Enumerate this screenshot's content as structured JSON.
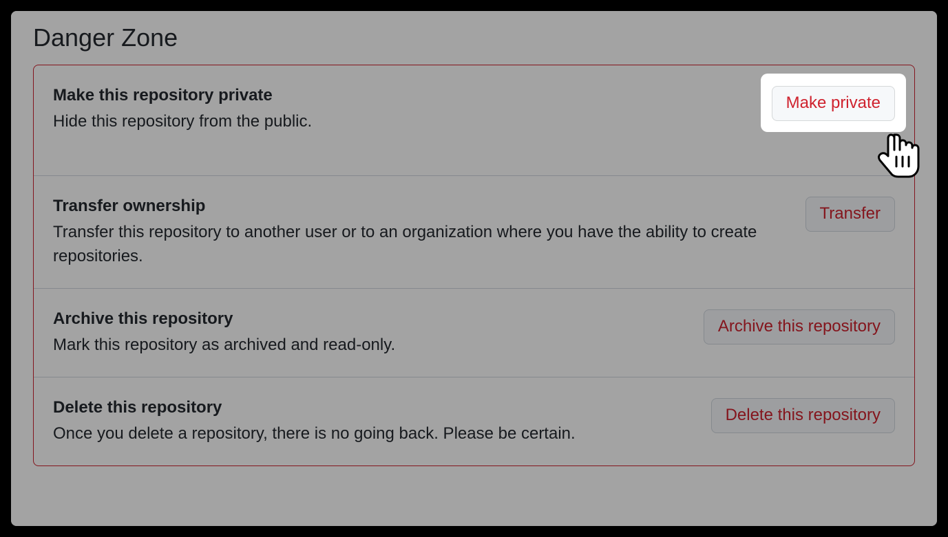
{
  "section": {
    "title": "Danger Zone"
  },
  "rows": [
    {
      "title": "Make this repository private",
      "desc": "Hide this repository from the public.",
      "button": "Make private",
      "highlighted": true
    },
    {
      "title": "Transfer ownership",
      "desc": "Transfer this repository to another user or to an organization where you have the ability to create repositories.",
      "button": "Transfer",
      "highlighted": false
    },
    {
      "title": "Archive this repository",
      "desc": "Mark this repository as archived and read-only.",
      "button": "Archive this repository",
      "highlighted": false
    },
    {
      "title": "Delete this repository",
      "desc": "Once you delete a repository, there is no going back. Please be certain.",
      "button": "Delete this repository",
      "highlighted": false
    }
  ]
}
